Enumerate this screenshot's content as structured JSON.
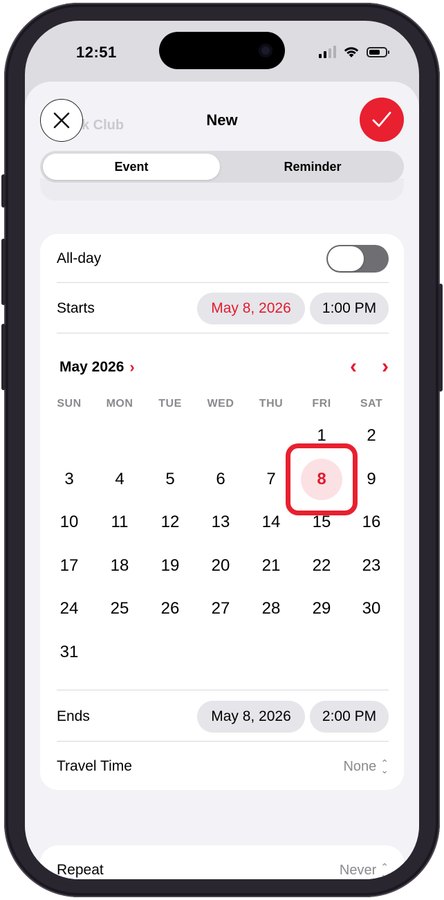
{
  "status_bar": {
    "time": "12:51"
  },
  "sheet": {
    "ghost_text": "k Club",
    "title": "New",
    "close_icon": "close-icon",
    "confirm_icon": "checkmark-icon",
    "tabs": [
      {
        "label": "Event",
        "active": true
      },
      {
        "label": "Reminder",
        "active": false
      }
    ]
  },
  "form": {
    "all_day": {
      "label": "All-day",
      "on": false
    },
    "starts": {
      "label": "Starts",
      "date": "May 8, 2026",
      "time": "1:00 PM"
    },
    "calendar": {
      "month_label": "May 2026",
      "weekdays": [
        "SUN",
        "MON",
        "TUE",
        "WED",
        "THU",
        "FRI",
        "SAT"
      ],
      "first_weekday_index": 5,
      "days_in_month": 31,
      "selected_day": 8
    },
    "ends": {
      "label": "Ends",
      "date": "May 8, 2026",
      "time": "2:00 PM"
    },
    "travel_time": {
      "label": "Travel Time",
      "value": "None"
    },
    "repeat": {
      "label": "Repeat",
      "value": "Never"
    }
  },
  "colors": {
    "accent": "#e31b2c",
    "selected_bg": "#fce1e4",
    "sheet_bg": "#f2f2f7"
  }
}
